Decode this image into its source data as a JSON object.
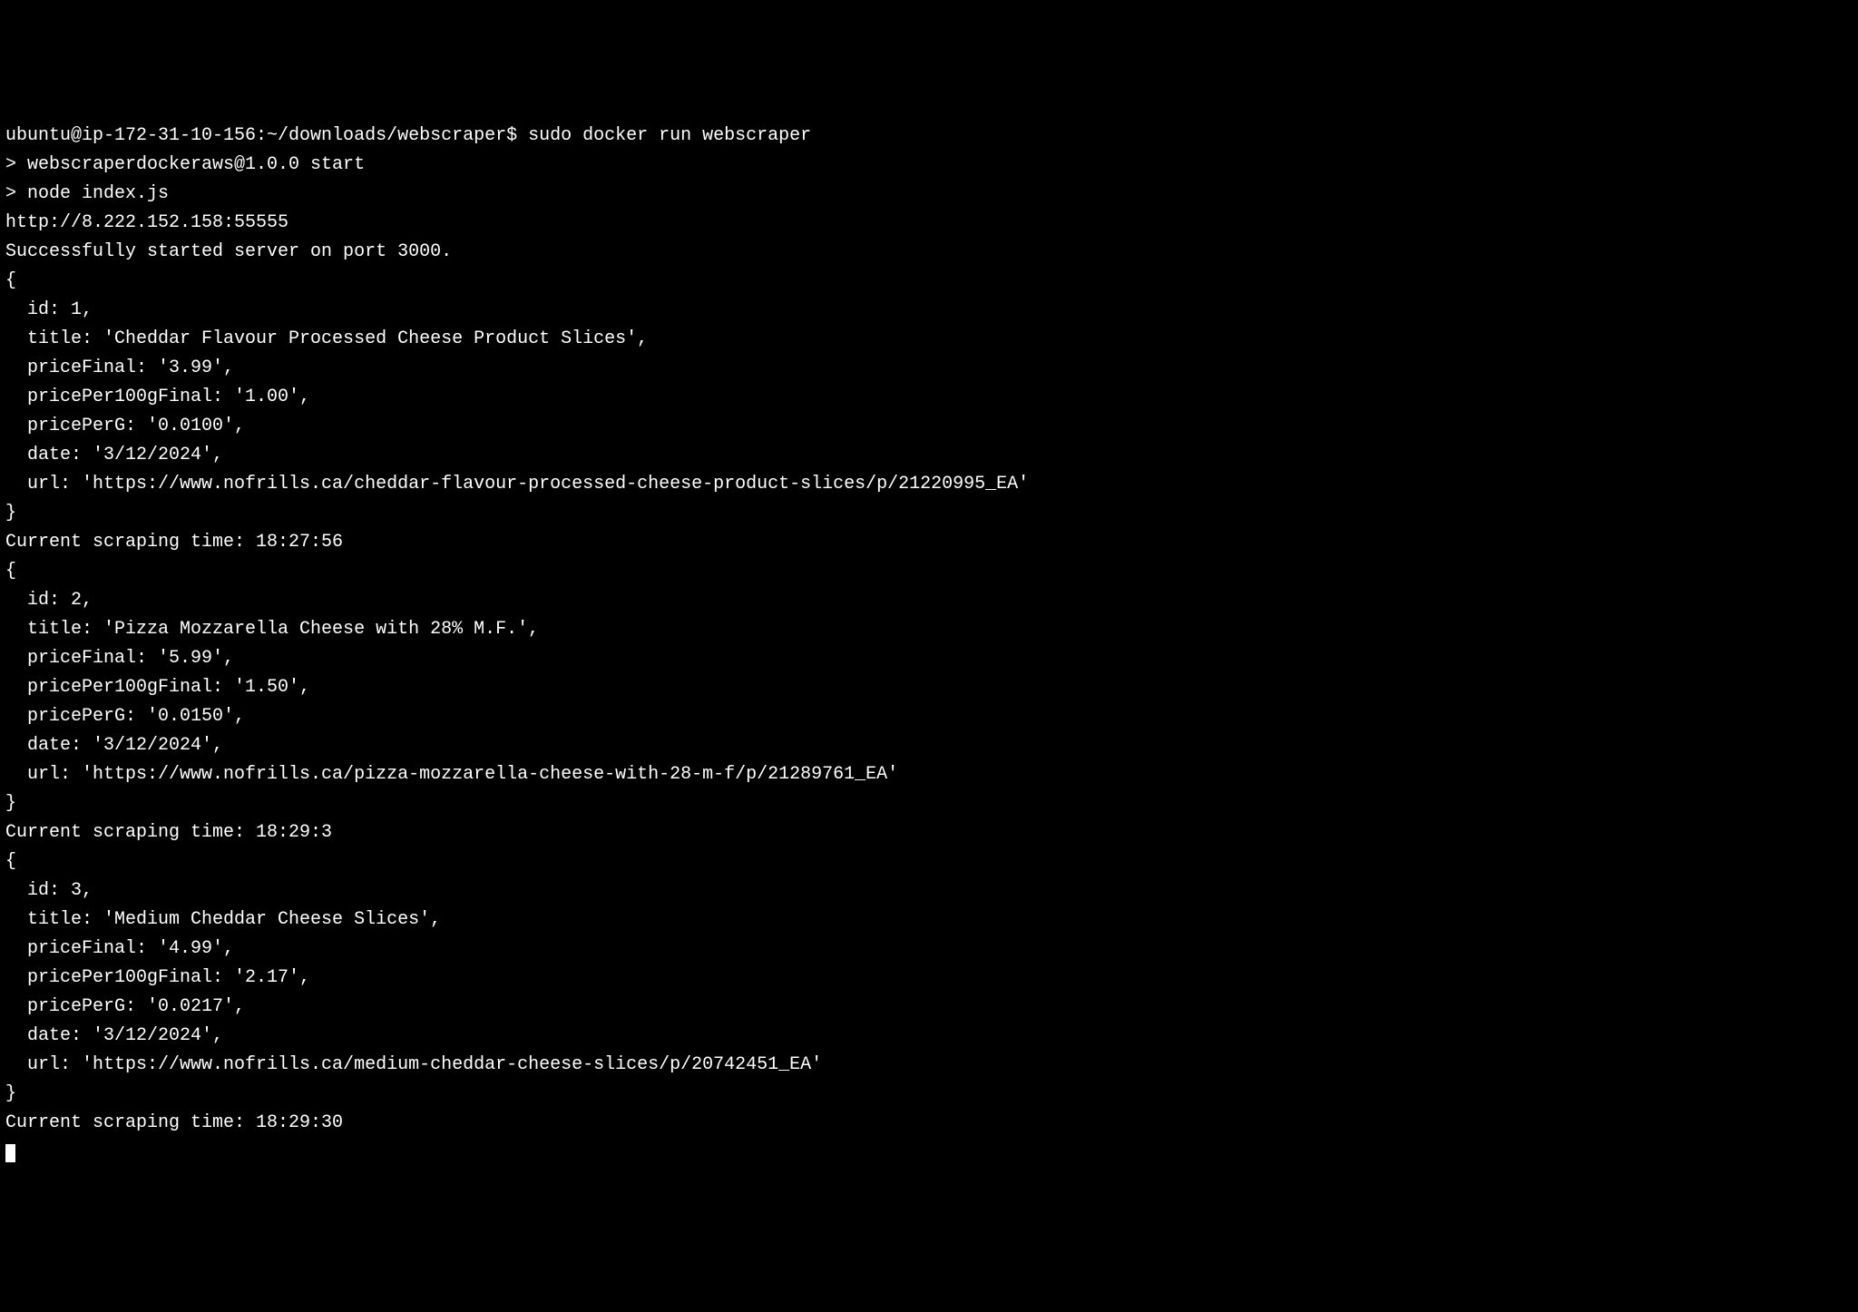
{
  "prompt": {
    "user_host": "ubuntu@ip-172-31-10-156",
    "cwd": "~/downloads/webscraper",
    "sep": "$",
    "command": "sudo docker run webscraper"
  },
  "npm_start": {
    "line1": "> webscraperdockeraws@1.0.0 start",
    "line2": "> node index.js"
  },
  "proxy_url": "http://8.222.152.158:55555",
  "server_msg": "Successfully started server on port 3000.",
  "records": [
    {
      "id": 1,
      "title": "Cheddar Flavour Processed Cheese Product Slices",
      "priceFinal": "3.99",
      "pricePer100gFinal": "1.00",
      "pricePerG": "0.0100",
      "date": "3/12/2024",
      "url": "https://www.nofrills.ca/cheddar-flavour-processed-cheese-product-slices/p/21220995_EA",
      "scrape_time": "18:27:56"
    },
    {
      "id": 2,
      "title": "Pizza Mozzarella Cheese with 28% M.F.",
      "priceFinal": "5.99",
      "pricePer100gFinal": "1.50",
      "pricePerG": "0.0150",
      "date": "3/12/2024",
      "url": "https://www.nofrills.ca/pizza-mozzarella-cheese-with-28-m-f/p/21289761_EA",
      "scrape_time": "18:29:3"
    },
    {
      "id": 3,
      "title": "Medium Cheddar Cheese Slices",
      "priceFinal": "4.99",
      "pricePer100gFinal": "2.17",
      "pricePerG": "0.0217",
      "date": "3/12/2024",
      "url": "https://www.nofrills.ca/medium-cheddar-cheese-slices/p/20742451_EA",
      "scrape_time": "18:29:30"
    }
  ],
  "labels": {
    "id": "id",
    "title": "title",
    "priceFinal": "priceFinal",
    "pricePer100gFinal": "pricePer100gFinal",
    "pricePerG": "pricePerG",
    "date": "date",
    "url": "url",
    "scrape_prefix": "Current scraping time: "
  }
}
